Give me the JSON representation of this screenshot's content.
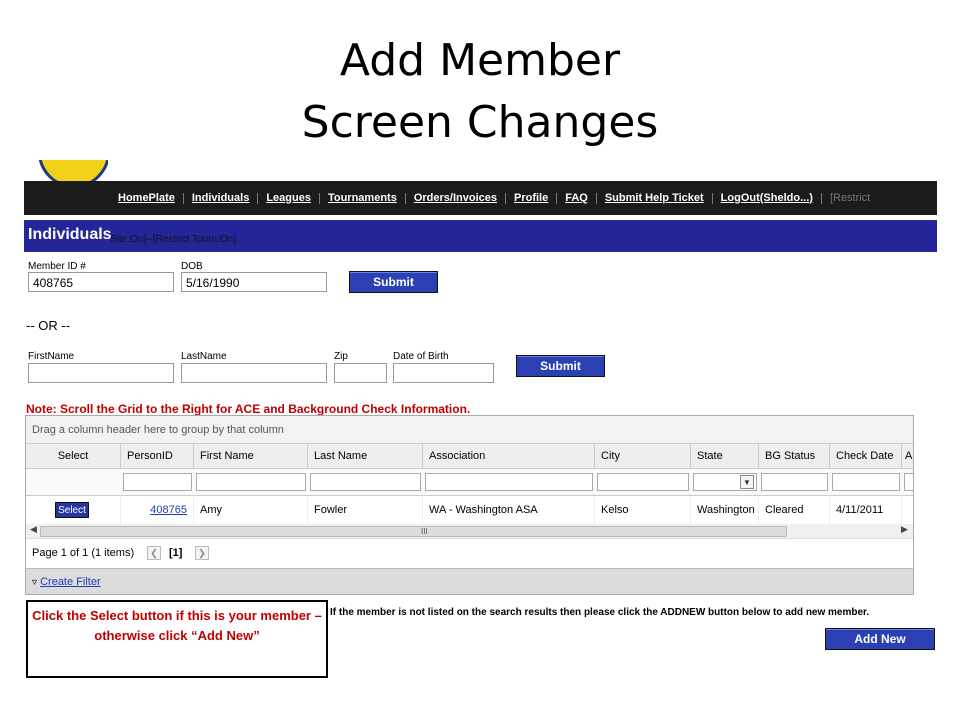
{
  "slide": {
    "title_line1": "Add Member",
    "title_line2": "Screen Changes"
  },
  "nav": {
    "items": [
      "HomePlate",
      "Individuals",
      "Leagues",
      "Tournaments",
      "Orders/Invoices",
      "Profile",
      "FAQ",
      "Submit Help Ticket",
      "LogOut(Sheldo...)",
      "[Restrict"
    ]
  },
  "header": {
    "title": "Individuals",
    "subtitle": "Site:On]--[Restrict Tourn:On]"
  },
  "search1": {
    "member_id_label": "Member ID #",
    "member_id_value": "408765",
    "dob_label": "DOB",
    "dob_value": "5/16/1990",
    "submit_label": "Submit"
  },
  "or_text": "-- OR --",
  "search2": {
    "firstname_label": "FirstName",
    "lastname_label": "LastName",
    "zip_label": "Zip",
    "dob_label": "Date of Birth",
    "submit_label": "Submit"
  },
  "note": "Note: Scroll the Grid to the Right for ACE and Background Check Information.",
  "grid": {
    "group_hint": "Drag a column header here to group by that column",
    "columns": [
      "Select",
      "PersonID",
      "First Name",
      "Last Name",
      "Association",
      "City",
      "State",
      "BG Status",
      "Check Date",
      "A"
    ],
    "row": {
      "select_label": "Select",
      "person_id": "408765",
      "first_name": "Amy",
      "last_name": "Fowler",
      "association": "WA - Washington ASA",
      "city": "Kelso",
      "state": "Washington",
      "bg_status": "Cleared",
      "check_date": "4/11/2011"
    },
    "scroll_grip": "III",
    "pager_text": "Page 1 of 1 (1 items)",
    "current_page": "[1]",
    "create_filter": "Create Filter"
  },
  "bottom_message": "If the member is not listed on the search results then please click the ADDNEW button below to add new member.",
  "addnew_label": "Add New",
  "callout": "Click the Select button if this is your member – otherwise click “Add New”",
  "colors": {
    "nav_bg": "#1b1b1b",
    "header_band": "#25259a",
    "button_blue": "#2a40b3",
    "note_red": "#c00000",
    "link_blue": "#1d3fb5"
  }
}
